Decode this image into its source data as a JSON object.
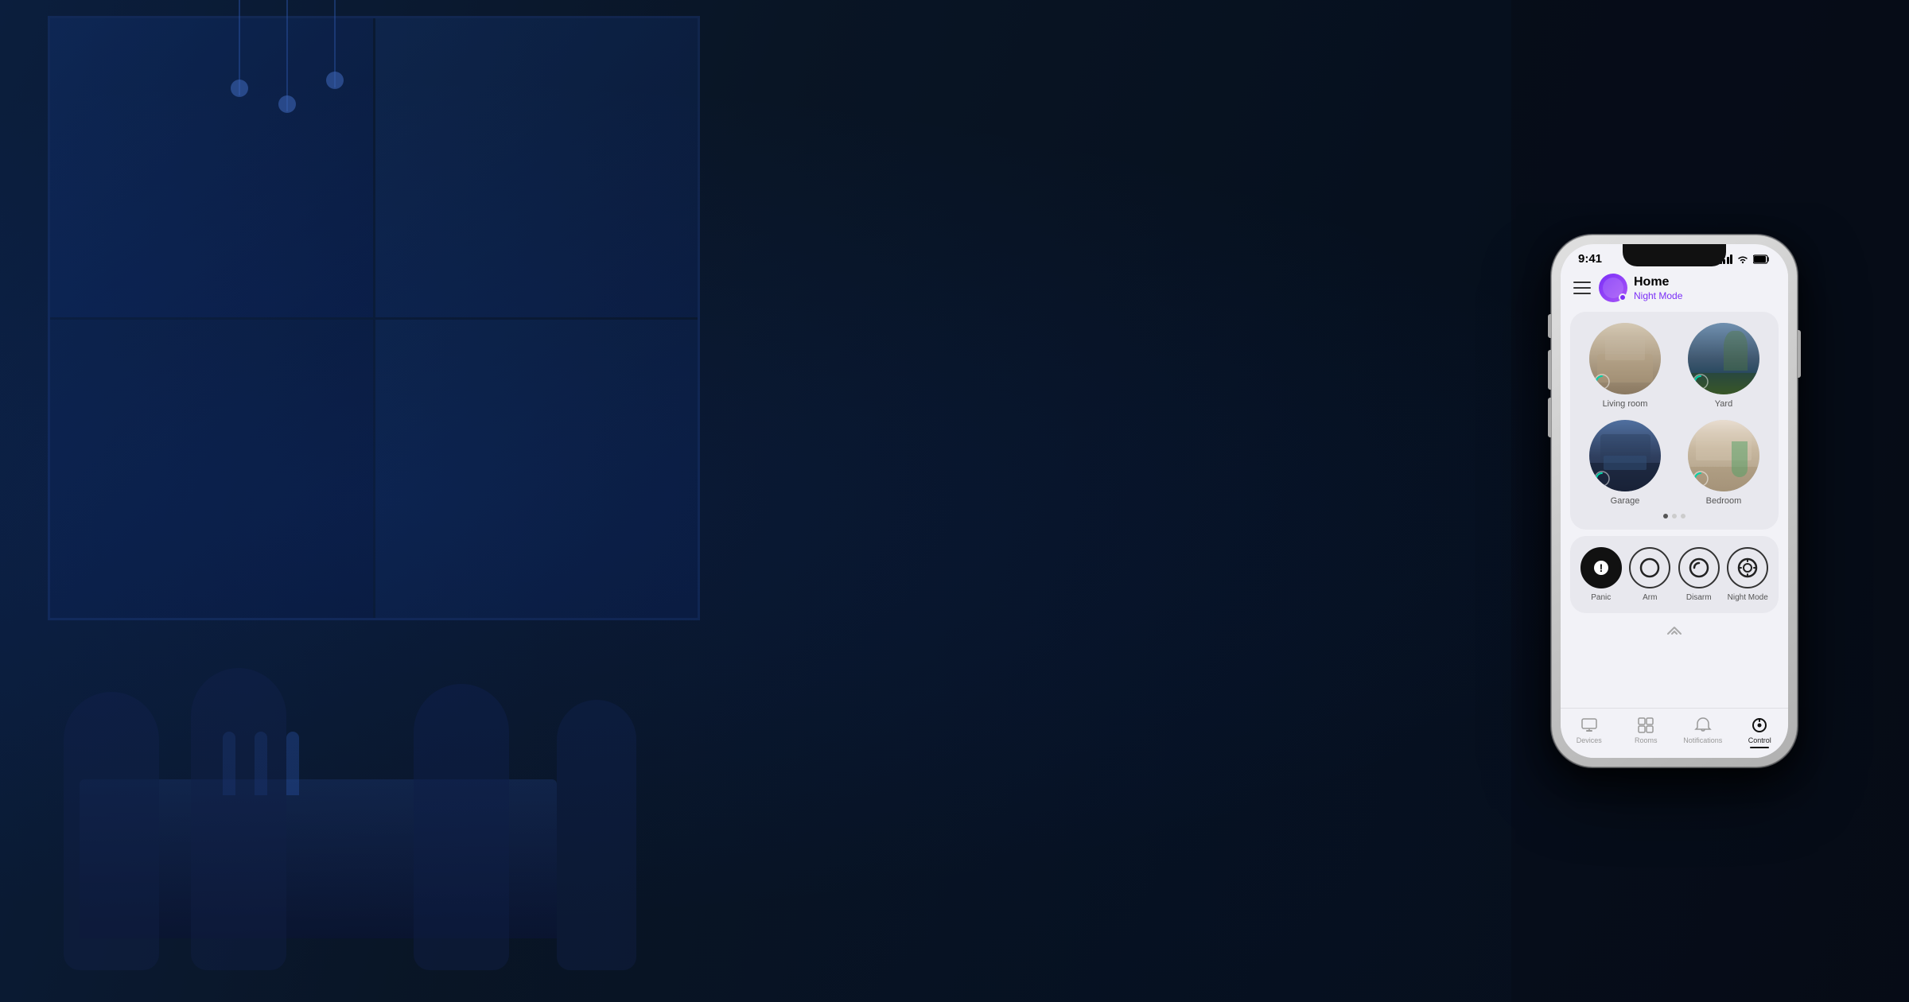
{
  "background": {
    "color": "#0a1628"
  },
  "status_bar": {
    "time": "9:41",
    "signal": "signal",
    "wifi": "wifi",
    "battery": "battery"
  },
  "header": {
    "menu_label": "menu",
    "title": "Home",
    "subtitle": "Night Mode",
    "avatar_label": "avatar"
  },
  "rooms_card": {
    "rooms": [
      {
        "id": "living_room",
        "label": "Living room",
        "img": "living"
      },
      {
        "id": "yard",
        "label": "Yard",
        "img": "yard"
      },
      {
        "id": "garage",
        "label": "Garage",
        "img": "garage"
      },
      {
        "id": "bedroom",
        "label": "Bedroom",
        "img": "bedroom"
      }
    ],
    "dots": [
      {
        "active": true
      },
      {
        "active": false
      },
      {
        "active": false
      }
    ]
  },
  "security_card": {
    "controls": [
      {
        "id": "panic",
        "label": "Panic",
        "icon": "panic"
      },
      {
        "id": "arm",
        "label": "Arm",
        "icon": "arm"
      },
      {
        "id": "disarm",
        "label": "Disarm",
        "icon": "disarm"
      },
      {
        "id": "night_mode",
        "label": "Night Mode",
        "icon": "night-mode"
      }
    ]
  },
  "bottom_nav": {
    "items": [
      {
        "id": "devices",
        "label": "Devices",
        "active": false
      },
      {
        "id": "rooms",
        "label": "Rooms",
        "active": false
      },
      {
        "id": "notifications",
        "label": "Notifications",
        "active": false
      },
      {
        "id": "control",
        "label": "Control",
        "active": true
      }
    ]
  }
}
